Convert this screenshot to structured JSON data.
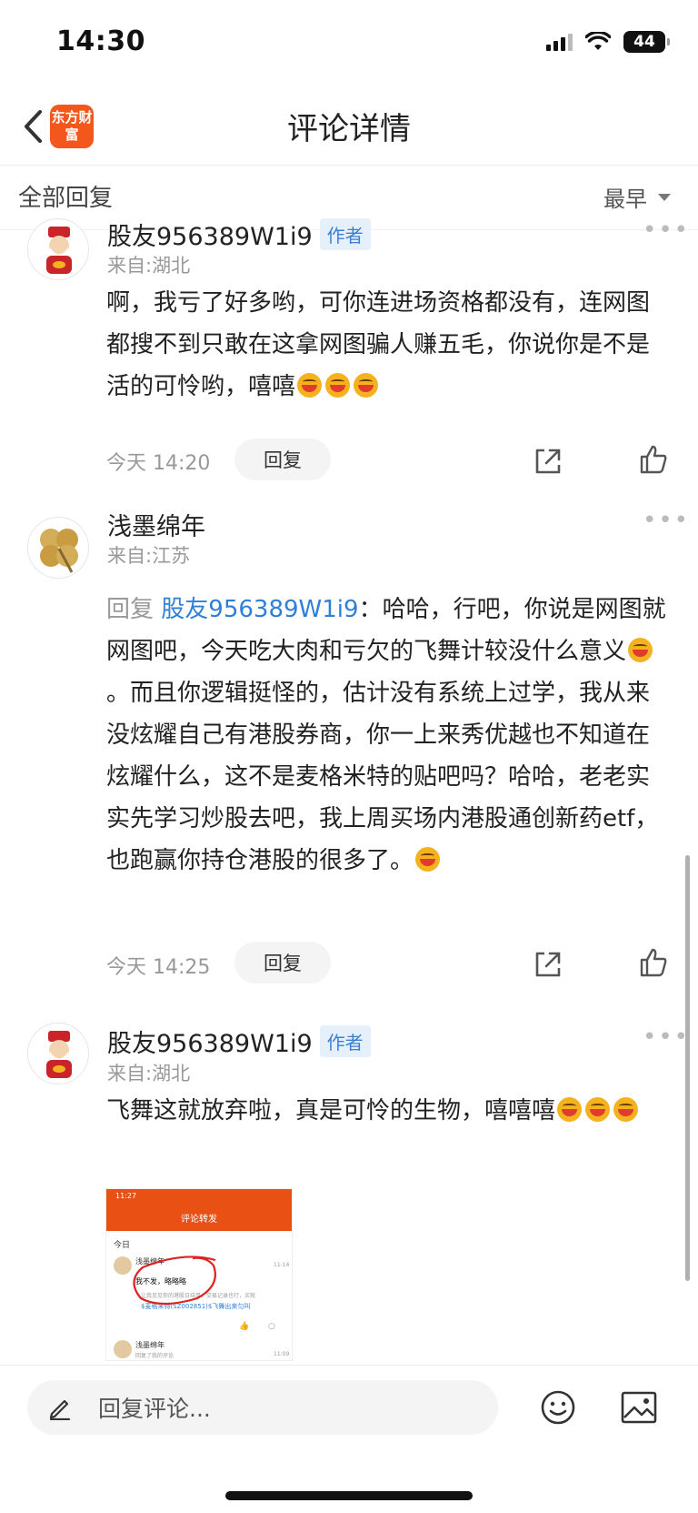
{
  "status_bar": {
    "time": "14:30",
    "battery": "44"
  },
  "nav": {
    "logo_text": "东方财富",
    "title": "评论详情"
  },
  "filter": {
    "label": "全部回复",
    "sort_label": "最早"
  },
  "comments": [
    {
      "username": "股友956389W1i9",
      "author_badge": "作者",
      "location": "来自:湖北",
      "text": "啊，我亏了好多哟，可你连进场资格都没有，连网图都搜不到只敢在这拿网图骗人赚五毛，你说你是不是活的可怜哟，嘻嘻",
      "time": "今天 14:20",
      "reply_label": "回复"
    },
    {
      "username": "浅墨绵年",
      "location": "来自:江苏",
      "reply_prefix": "回复",
      "mention": "股友956389W1i9",
      "text_a": "：哈哈，行吧，你说是网图就网图吧，今天吃大肉和亏欠的飞舞计较没什么意义",
      "text_b": "。而且你逻辑挺怪的，估计没有系统上过学，我从来没炫耀自己有港股券商，你一上来秀优越也不知道在炫耀什么，这不是麦格米特的贴吧吗？哈哈，老老实实先学习炒股去吧，我上周买场内港股通创新药etf，也跑赢你持仓港股的很多了。",
      "time": "今天 14:25",
      "reply_label": "回复"
    },
    {
      "username": "股友956389W1i9",
      "author_badge": "作者",
      "location": "来自:湖北",
      "text": "飞舞这就放弃啦，真是可怜的生物，嘻嘻嘻"
    }
  ],
  "screenshot_thumb": {
    "status": "11:27",
    "title": "评论转发",
    "section": "今日",
    "name1": "浅墨绵年",
    "time1": "11:14",
    "text1": "我不发，略略略",
    "line2": "让我见见你的港股日结单、交易记录也行，买就",
    "link": "$麦格米特(SZ002851)$飞舞出来匀叫",
    "name2": "浅墨绵年",
    "sub2": "回复了我的评论",
    "time2": "11:09"
  },
  "bottom": {
    "input_placeholder": "回复评论..."
  }
}
